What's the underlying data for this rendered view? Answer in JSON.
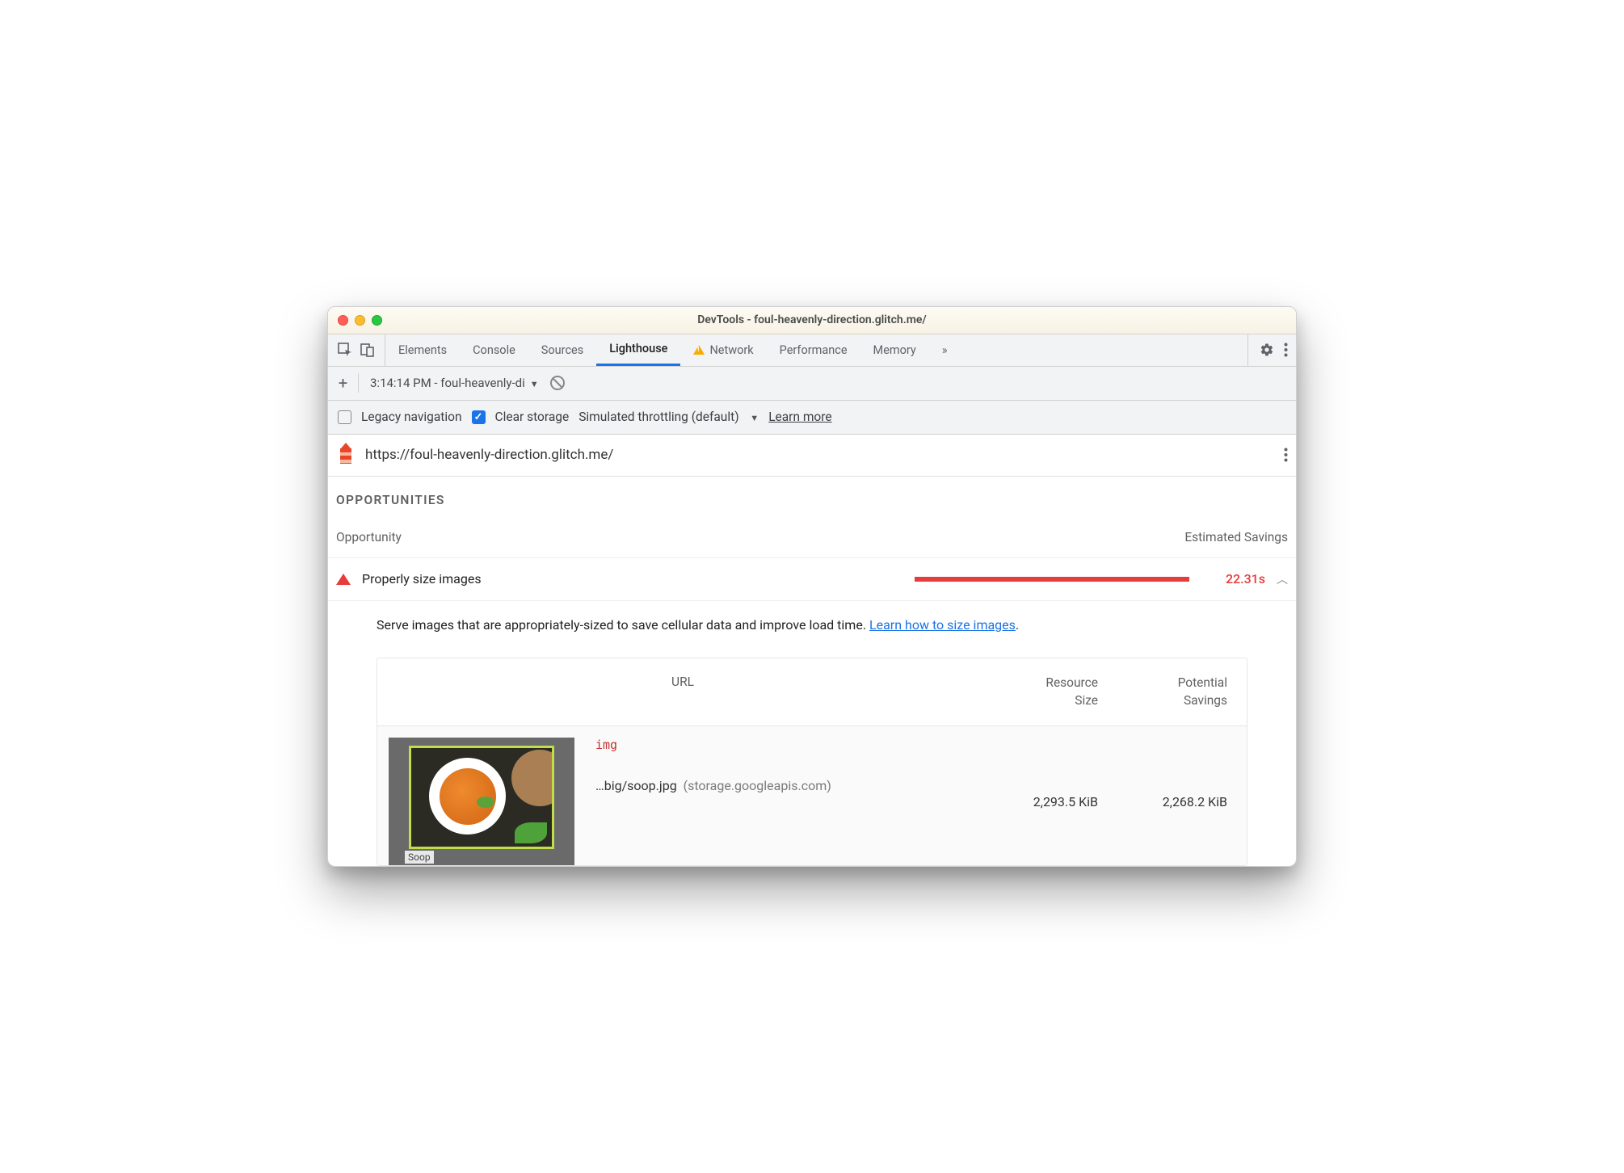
{
  "window": {
    "title": "DevTools - foul-heavenly-direction.glitch.me/"
  },
  "tabs": {
    "items": [
      "Elements",
      "Console",
      "Sources",
      "Lighthouse",
      "Network",
      "Performance",
      "Memory"
    ],
    "active": "Lighthouse",
    "overflow": "»"
  },
  "secondbar": {
    "report_dropdown": "3:14:14 PM - foul-heavenly-di"
  },
  "options": {
    "legacy_label": "Legacy navigation",
    "clear_label": "Clear storage",
    "throttling_label": "Simulated throttling (default)",
    "learn_more": "Learn more"
  },
  "urlbar": {
    "url": "https://foul-heavenly-direction.glitch.me/"
  },
  "section": {
    "title": "OPPORTUNITIES",
    "col_opportunity": "Opportunity",
    "col_savings": "Estimated Savings"
  },
  "audit": {
    "title": "Properly size images",
    "value": "22.31s",
    "description_prefix": "Serve images that are appropriately-sized to save cellular data and improve load time. ",
    "description_link": "Learn how to size images",
    "description_suffix": "."
  },
  "table": {
    "headers": {
      "url": "URL",
      "size": "Resource Size",
      "savings": "Potential Savings"
    },
    "rows": [
      {
        "tag": "img",
        "path": "…big/soop.jpg",
        "host": "(storage.googleapis.com)",
        "size": "2,293.5 KiB",
        "savings": "2,268.2 KiB",
        "caption": "Soop"
      }
    ]
  }
}
